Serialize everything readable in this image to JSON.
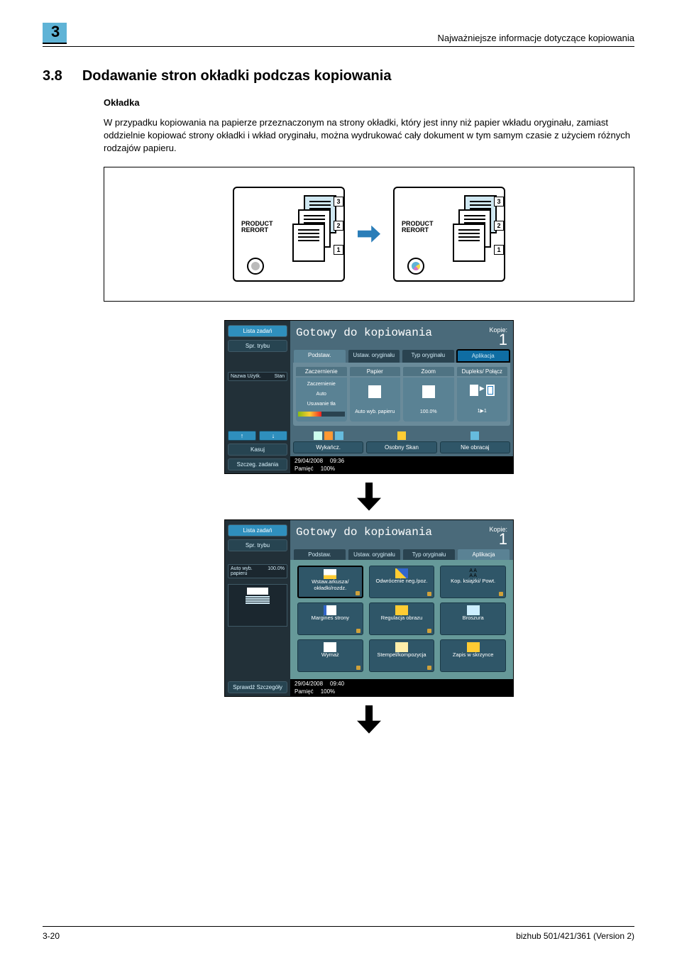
{
  "header": {
    "running": "Najważniejsze informacje dotyczące kopiowania",
    "chapter_tab": "3"
  },
  "section": {
    "num": "3.8",
    "title": "Dodawanie stron okładki podczas kopiowania"
  },
  "sub": {
    "title": "Okładka"
  },
  "paragraph": "W przypadku kopiowania na papierze przeznaczonym na strony okładki, który jest inny niż papier wkładu oryginału, zamiast oddzielnie kopiować strony okładki i wkład oryginału, można wydrukować cały dokument w tym samym czasie z użyciem różnych rodzajów papieru.",
  "diagram": {
    "report_label": "PRODUCT\nRERORT",
    "nums": [
      "3",
      "2",
      "1"
    ]
  },
  "screen1": {
    "title": "Gotowy do kopiowania",
    "kopie_label": "Kopie:",
    "kopie_value": "1",
    "left_tabs": {
      "lista": "Lista zadań",
      "spr": "Spr. trybu",
      "stan": "Stan",
      "nazwa": "Nazwa Użytk.",
      "kasuj": "Kasuj",
      "szczeg": "Szczeg. zadania"
    },
    "tabs": [
      "Podstaw.",
      "Ustaw. oryginału",
      "Typ oryginału",
      "Aplikacja"
    ],
    "columns": [
      "Zaczernienie",
      "Papier",
      "Zoom",
      "Dupleks/ Połącz"
    ],
    "col_vals": {
      "zacz1": "Zaczernienie",
      "zacz2": "Auto",
      "zacz3": "Usuwanie tła",
      "papier": "Auto wyb. papieru",
      "zoom": "100.0%",
      "dup": "1▶1"
    },
    "bottom": [
      "Wykańcz.",
      "Osobny Skan",
      "Nie obracaj"
    ],
    "footer_date": "29/04/2008",
    "footer_time": "09:36",
    "footer_mem": "Pamięć",
    "footer_pct": "100%"
  },
  "screen2": {
    "title": "Gotowy do kopiowania",
    "kopie_label": "Kopie:",
    "kopie_value": "1",
    "left_tabs": {
      "lista": "Lista zadań",
      "spr": "Spr. trybu",
      "sprawdz": "Sprawdź Szczegóły"
    },
    "mini": {
      "label": "Auto wyb. papieru",
      "val": "100.0%"
    },
    "tabs": [
      "Podstaw.",
      "Ustaw. oryginału",
      "Typ oryginału",
      "Aplikacja"
    ],
    "apps": [
      "Wstaw.arkusza/ okładki/rozdz.",
      "Odwrócenie neg./poz.",
      "Kop. książki/ Powt.",
      "Margines strony",
      "Regulacja obrazu",
      "Broszura",
      "Wymaż",
      "Stempel/kompozycja",
      "Zapis w skrzynce"
    ],
    "footer_date": "29/04/2008",
    "footer_time": "09:40",
    "footer_mem": "Pamięć",
    "footer_pct": "100%"
  },
  "footer": {
    "left": "3-20",
    "right": "bizhub 501/421/361 (Version 2)"
  }
}
